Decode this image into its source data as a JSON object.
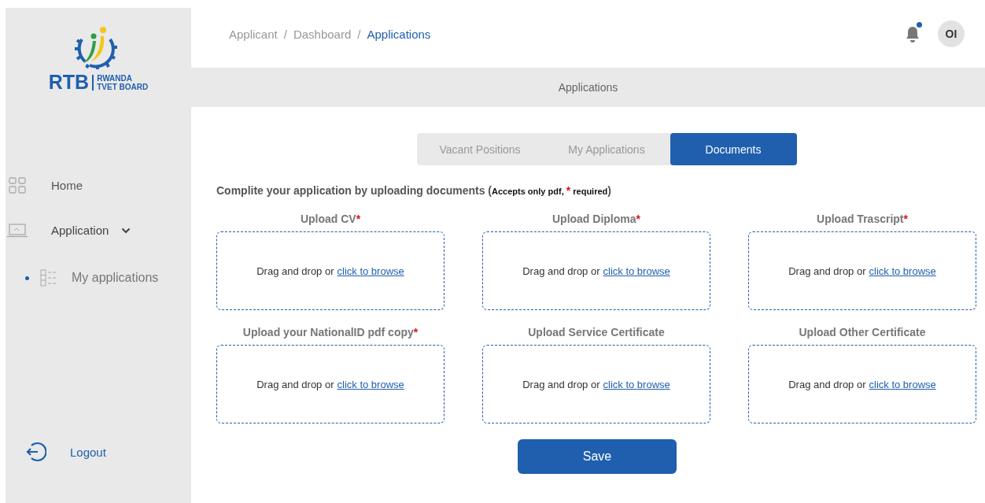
{
  "logo": {
    "initials": "RTB",
    "line1": "RWANDA",
    "line2": "TVET BOARD"
  },
  "sidebar": {
    "items": [
      {
        "label": "Home",
        "kind": "home"
      },
      {
        "label": "Application",
        "kind": "application",
        "expanded": true,
        "children": [
          {
            "label": "My applications",
            "kind": "list"
          }
        ]
      }
    ],
    "logout": "Logout"
  },
  "breadcrumb": [
    {
      "label": "Applicant",
      "selected": false
    },
    {
      "label": "Dashboard",
      "selected": false
    },
    {
      "label": "Applications",
      "selected": true
    }
  ],
  "breadcrumb_separator": "/",
  "notifications": {
    "unread": true
  },
  "avatar": "OI",
  "page_title": "Applications",
  "tabs": [
    {
      "label": "Vacant Positions",
      "selected": false
    },
    {
      "label": "My Applications",
      "selected": false
    },
    {
      "label": "Documents",
      "selected": true
    }
  ],
  "instructions": {
    "text": "Complite your application by uploading documents (",
    "note": "Accepts only pdf,",
    "note_end": "required",
    "close": ")"
  },
  "required_mark": "*",
  "uploads": [
    {
      "label": "Upload CV",
      "required": true,
      "prompt": "Drag and drop or",
      "link": "click to browse"
    },
    {
      "label": "Upload Diploma",
      "required": true,
      "prompt": "Drag and drop or",
      "link": "click to browse"
    },
    {
      "label": "Upload Trascript",
      "required": true,
      "prompt": "Drag and drop or",
      "link": "click to browse"
    },
    {
      "label": "Upload your NationalID pdf copy",
      "required": true,
      "prompt": "Drag and drop or",
      "link": "click to browse"
    },
    {
      "label": "Upload Service Certificate",
      "required": false,
      "prompt": "Drag and drop or",
      "link": "click to browse"
    },
    {
      "label": "Upload Other Certificate",
      "required": false,
      "prompt": "Drag and drop or",
      "link": "click to browse"
    }
  ],
  "save_button": "Save"
}
